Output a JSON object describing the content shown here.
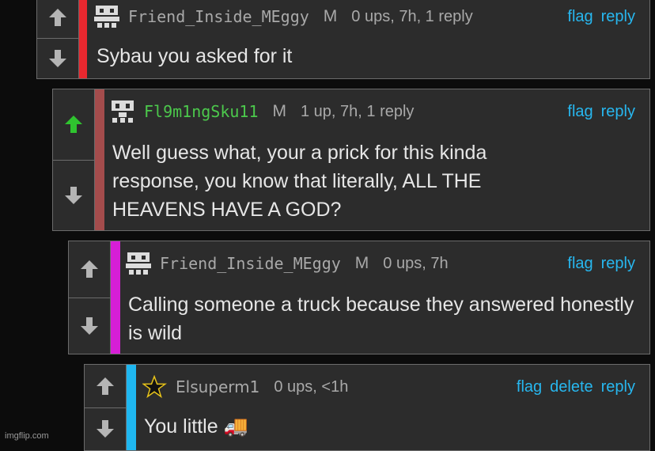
{
  "comments": [
    {
      "username": "Friend_Inside_MEggy",
      "mod_label": "M",
      "stats": "0 ups, 7h, 1 reply",
      "actions": [
        "flag",
        "reply"
      ],
      "text": "Sybau you asked for it",
      "bar_color": "#e8282f",
      "upvoted": false
    },
    {
      "username": "Fl9m1ngSku11",
      "mod_label": "M",
      "stats": "1 up, 7h, 1 reply",
      "actions": [
        "flag",
        "reply"
      ],
      "text": "Well guess what, your a prick for this kinda response, you know that literally, ALL THE HEAVENS HAVE A GOD?",
      "bar_color": "#a44c4c",
      "upvoted": true
    },
    {
      "username": "Friend_Inside_MEggy",
      "mod_label": "M",
      "stats": "0 ups, 7h",
      "actions": [
        "flag",
        "reply"
      ],
      "text": "Calling someone a truck because they answered honestly is wild",
      "bar_color": "#d61ed6",
      "upvoted": false
    },
    {
      "username": "Elsuperm1",
      "mod_label": "",
      "stats": "0 ups, <1h",
      "actions": [
        "flag",
        "delete",
        "reply"
      ],
      "text": "You little 🚚",
      "bar_color": "#1fb7f0",
      "upvoted": false
    }
  ],
  "icons": {
    "upvote": "arrow-up-icon",
    "downvote": "arrow-down-icon",
    "avatar": "pixel-face-avatar",
    "star_avatar": "star-icon"
  },
  "colors": {
    "link": "#27b7ef",
    "username_green": "#4cc94c",
    "upvoted_arrow": "#2fc42f",
    "arrow_default": "#b5b5b5"
  },
  "watermark": "imgflip.com"
}
